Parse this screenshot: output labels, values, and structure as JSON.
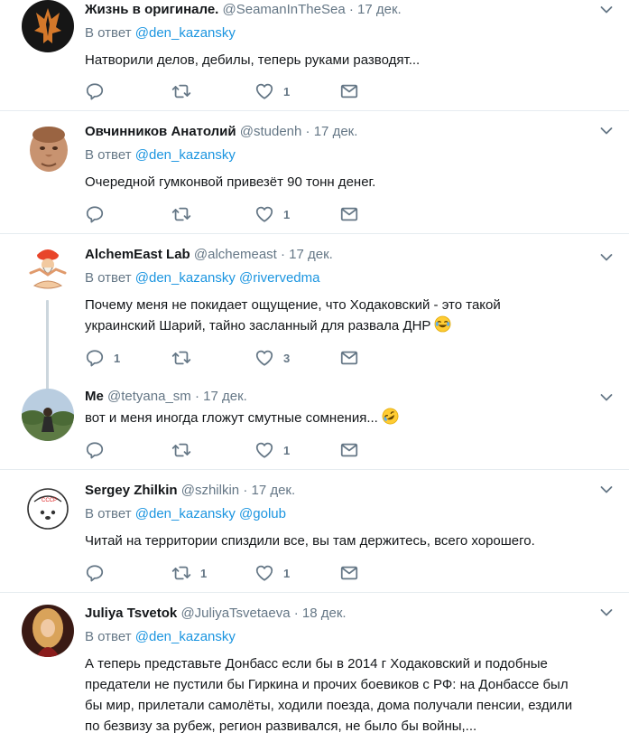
{
  "reply_prefix": "В ответ",
  "tweets": [
    {
      "name": "Жизнь в оригинале.",
      "handle": "@SeamanInTheSea",
      "sep": "·",
      "time": "17 дек.",
      "reply_to": [
        "@den_kazansky"
      ],
      "text_lines": [
        "Натворили делов, дебилы, теперь руками разводят..."
      ],
      "replies": "",
      "retweets": "",
      "likes": "1"
    },
    {
      "name": "Овчинников Анатолий",
      "handle": "@studenh",
      "sep": "·",
      "time": "17 дек.",
      "reply_to": [
        "@den_kazansky"
      ],
      "text_lines": [
        "Очередной гумконвой привезёт 90 тонн денег."
      ],
      "replies": "",
      "retweets": "",
      "likes": "1"
    },
    {
      "name": "AlchemEast Lab",
      "handle": "@alchemeast",
      "sep": "·",
      "time": "17 дек.",
      "reply_to": [
        "@den_kazansky",
        "@rivervedma"
      ],
      "text_lines": [
        "Почему меня не покидает ощущение, что Ходаковский - это такой",
        "украинский Шарий, тайно засланный для развала ДНР"
      ],
      "emoji": "face-with-tears-of-joy",
      "replies": "1",
      "retweets": "",
      "likes": "3"
    },
    {
      "name": "Me",
      "handle": "@tetyana_sm",
      "sep": "·",
      "time": "17 дек.",
      "text_lines": [
        "вот и меня иногда гложут смутные сомнения..."
      ],
      "emoji": "rolling-on-floor-laughing",
      "replies": "",
      "retweets": "",
      "likes": "1"
    },
    {
      "name": "Sergey Zhilkin",
      "handle": "@szhilkin",
      "sep": "·",
      "time": "17 дек.",
      "reply_to": [
        "@den_kazansky",
        "@golub"
      ],
      "text_lines": [
        "Читай на территории спиздили все, вы там держитесь, всего хорошего."
      ],
      "replies": "",
      "retweets": "1",
      "likes": "1"
    },
    {
      "name": "Juliya Tsvetok",
      "handle": "@JuliyaTsvetaeva",
      "sep": "·",
      "time": "18 дек.",
      "reply_to": [
        "@den_kazansky"
      ],
      "text_lines": [
        "А теперь представьте Донбасс если бы в 2014 г Ходаковский и подобные",
        "предатели не пустили бы Гиркина и прочих боевиков с РФ: на Донбассе был",
        "бы мир, прилетали самолёты, ходили поезда, дома получали пенсии, ездили",
        "по безвизу за рубеж, регион развивался, не было бы войны,..."
      ]
    }
  ],
  "colors": {
    "link": "#1b95e0",
    "muted": "#657786",
    "text": "#14171a",
    "divider": "#e6ecf0"
  },
  "icons": {
    "reply": "speech-bubble-icon",
    "retweet": "retweet-arrows-icon",
    "like": "heart-icon",
    "dm": "envelope-icon",
    "more": "chevron-down-icon"
  }
}
